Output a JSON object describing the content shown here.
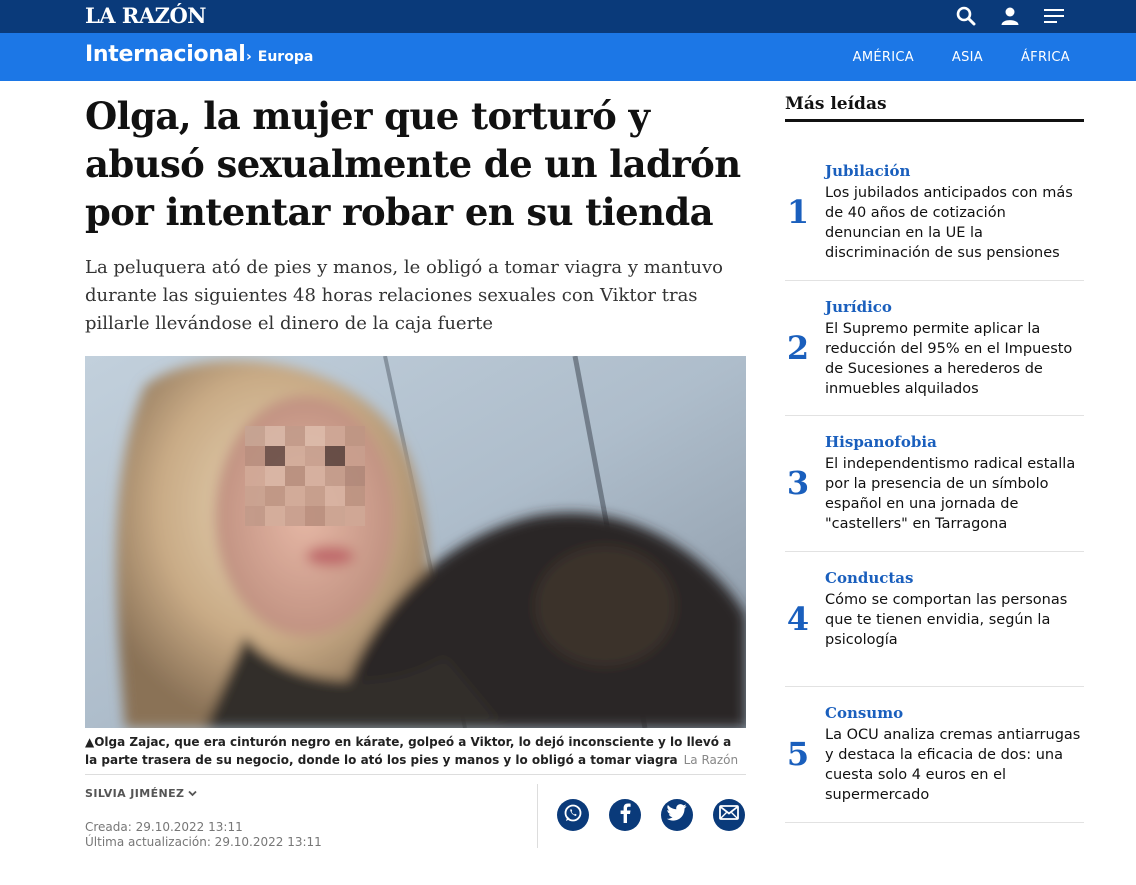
{
  "header": {
    "logo": "LA RAZÓN",
    "icons": [
      "search-icon",
      "user-icon",
      "menu-icon"
    ]
  },
  "section": {
    "title": "Internacional",
    "breadcrumb_sep": "›",
    "breadcrumb": "Europa",
    "regions": [
      "AMÉRICA",
      "ASIA",
      "ÁFRICA"
    ]
  },
  "article": {
    "headline": "Olga, la mujer que torturó y abusó sexualmente de un ladrón por intentar robar en su tienda",
    "dek": "La peluquera ató de pies y manos, le obligó a tomar viagra y mantuvo durante las siguientes 48 horas relaciones sexuales con Viktor tras pillarle llevándose el dinero de la caja fuerte",
    "caption": "▲Olga Zajac, que era cinturón negro en kárate, golpeó a Viktor, lo dejó inconsciente y lo llevó a la parte trasera de su negocio, donde lo ató los pies y manos y lo obligó a tomar viagra",
    "caption_credit": "La Razón",
    "author": "SILVIA JIMÉNEZ",
    "created": "Creada: 29.10.2022 13:11",
    "updated": "Última actualización: 29.10.2022 13:11",
    "share_icons": [
      "whatsapp-icon",
      "facebook-icon",
      "twitter-icon",
      "email-icon"
    ]
  },
  "sidebar": {
    "title": "Más leídas",
    "items": [
      {
        "num": "1",
        "kicker": "Jubilación",
        "text": "Los jubilados anticipados con más de 40 años de cotización denuncian en la UE la discriminación de sus pensiones"
      },
      {
        "num": "2",
        "kicker": "Jurídico",
        "text": "El Supremo permite aplicar la reducción del 95% en el Impuesto de Sucesiones a herederos de inmuebles alquilados"
      },
      {
        "num": "3",
        "kicker": "Hispanofobia",
        "text": "El independentismo radical estalla por la presencia de un símbolo español en una jornada de \"castellers\" en Tarragona"
      },
      {
        "num": "4",
        "kicker": "Conductas",
        "text": "Cómo se comportan las personas que te tienen envidia, según la psicología"
      },
      {
        "num": "5",
        "kicker": "Consumo",
        "text": "La OCU analiza cremas antiarrugas y destaca la eficacia de dos: una cuesta solo 4 euros en el supermercado"
      }
    ]
  },
  "colors": {
    "topbar": "#0a3a7a",
    "sectionbar": "#1c77e6",
    "accent": "#1a5fbd"
  }
}
